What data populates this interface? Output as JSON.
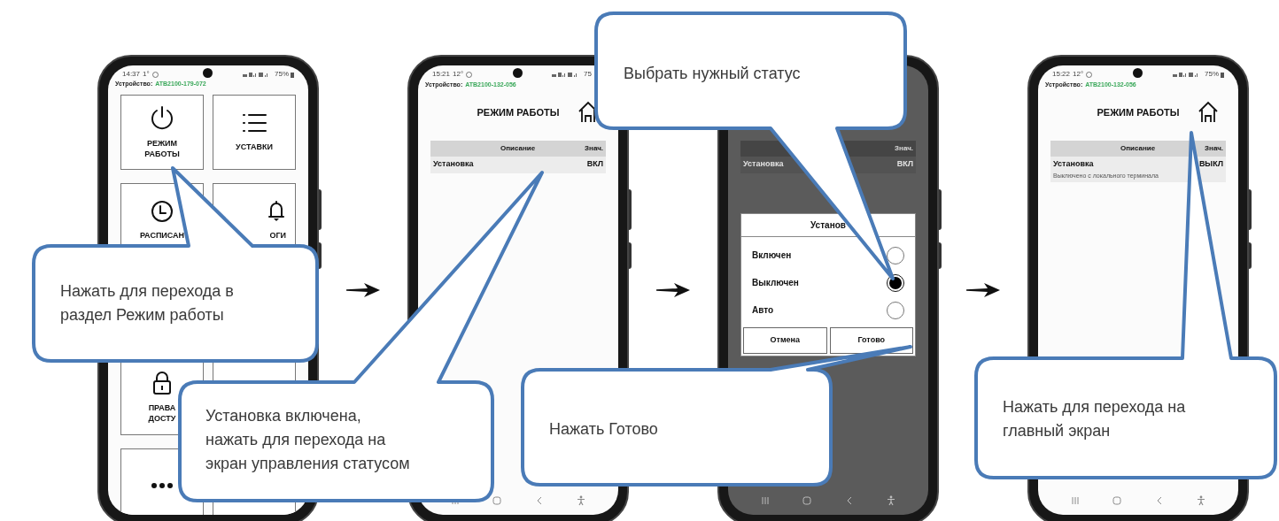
{
  "screens": [
    {
      "kind": "menu",
      "status": {
        "time": "14:37",
        "temp": "1°",
        "battery": "75%"
      },
      "device": {
        "label": "Устройство:",
        "id": "ATB2100-179-072"
      },
      "tiles": [
        {
          "lines": [
            "РЕЖИМ",
            "РАБОТЫ"
          ]
        },
        {
          "lines": [
            "УСТАВКИ"
          ]
        },
        {
          "lines": [
            "РАСПИСАН"
          ]
        },
        {
          "lines": [
            "ОГИ"
          ]
        },
        {
          "lines": [
            "ПРАВА",
            "ДОСТУ"
          ]
        },
        {
          "kind": "more"
        }
      ]
    },
    {
      "kind": "table",
      "status": {
        "time": "15:21",
        "temp": "12°",
        "battery": "75"
      },
      "device": {
        "label": "Устройство:",
        "id": "ATB2100-132-056"
      },
      "title": "РЕЖИМ РАБОТЫ",
      "columns": [
        "Описание",
        "Знач."
      ],
      "rows": [
        {
          "name": "Установка",
          "value": "ВКЛ"
        }
      ]
    },
    {
      "kind": "dialog",
      "columns": [
        "Знач."
      ],
      "rows": [
        {
          "name": "Установка",
          "value": "ВКЛ"
        }
      ],
      "dialog": {
        "title": "Установ",
        "options": [
          {
            "label": "Включен",
            "selected": false
          },
          {
            "label": "Выключен",
            "selected": true
          },
          {
            "label": "Авто",
            "selected": false
          }
        ],
        "buttons": [
          "Отмена",
          "Готово"
        ]
      }
    },
    {
      "kind": "table",
      "status": {
        "time": "15:22",
        "temp": "12°",
        "battery": "75%"
      },
      "device": {
        "label": "Устройство:",
        "id": "ATB2100-132-056"
      },
      "title": "РЕЖИМ РАБОТЫ",
      "columns": [
        "Описание",
        "Знач."
      ],
      "rows": [
        {
          "name": "Установка",
          "value": "ВЫКЛ",
          "note": "Выключено с локального терминала"
        }
      ]
    }
  ],
  "callouts": [
    {
      "lines": [
        "Нажать для перехода в",
        "раздел Режим работы"
      ]
    },
    {
      "lines": [
        "Установка включена,",
        "нажать для перехода на",
        "экран управления статусом"
      ]
    },
    {
      "lines": [
        "Выбрать нужный статус"
      ]
    },
    {
      "lines": [
        "Нажать Готово"
      ]
    },
    {
      "lines": [
        "Нажать для перехода на",
        "главный экран"
      ]
    }
  ]
}
